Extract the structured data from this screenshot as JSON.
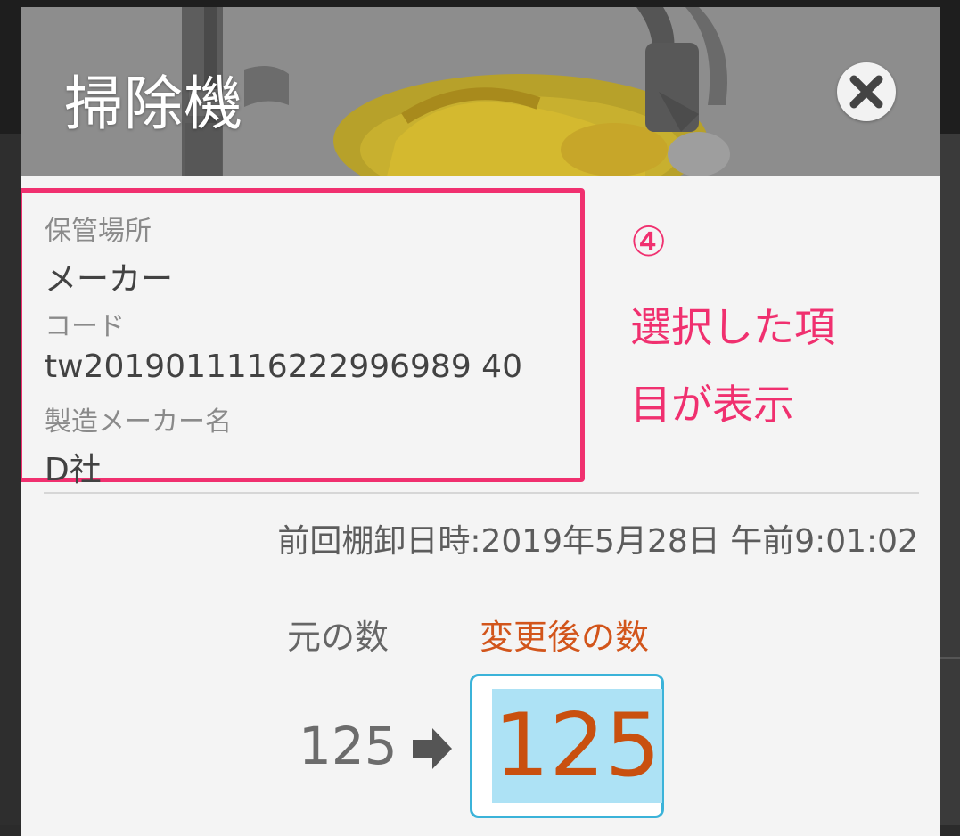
{
  "dialog": {
    "title": "掃除機",
    "header_icons": [
      "vacuum-cleaner-photo",
      "close-icon"
    ]
  },
  "info": {
    "fields": [
      {
        "label": "保管場所",
        "value": "メーカー"
      },
      {
        "label": "コード",
        "value": "tw2019011116222996989 40"
      },
      {
        "label": "製造メーカー名",
        "value": "D社"
      }
    ]
  },
  "annotation": {
    "number": "④",
    "line1": "選択した項",
    "line2": "目が表示"
  },
  "inventory": {
    "last_count": "前回棚卸日時:2019年5月28日 午前9:01:02",
    "original_label": "元の数",
    "new_label": "変更後の数",
    "original_value": "125",
    "new_value": "125",
    "arrow_icon": "arrow-right-icon"
  },
  "colors": {
    "highlight_border": "#f0306f",
    "annotation_text": "#f0306f",
    "new_value_text": "#c9500f",
    "input_border": "#3bb3d9",
    "selection": "#ade2f5"
  }
}
